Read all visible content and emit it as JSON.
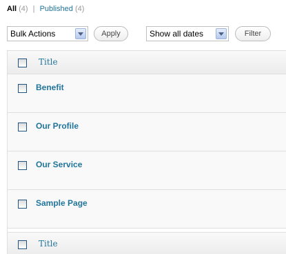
{
  "filters": {
    "all_label": "All",
    "all_count": "(4)",
    "separator": "|",
    "published_label": "Published",
    "published_count": "(4)"
  },
  "toolbar": {
    "bulk_actions": "Bulk Actions",
    "apply_label": "Apply",
    "dates": "Show all dates",
    "filter_label": "Filter"
  },
  "table": {
    "column_title": "Title",
    "footer_title": "Title",
    "rows": [
      {
        "title": "Benefit"
      },
      {
        "title": "Our Profile"
      },
      {
        "title": "Our Service"
      },
      {
        "title": "Sample Page"
      }
    ]
  },
  "colors": {
    "link": "#21759b",
    "row_background": "#f9f9f9",
    "border": "#dfdfdf"
  }
}
